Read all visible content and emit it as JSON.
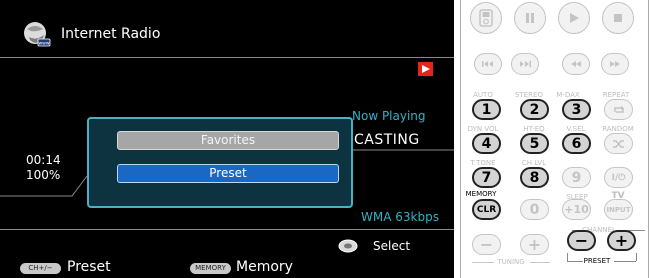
{
  "screen": {
    "source_title": "Internet Radio",
    "now_playing_label": "Now Playing",
    "station_fragment": "CASTING",
    "elapsed_time": "00:14",
    "progress": "100%",
    "codec": "WMA 63kbps",
    "select_label": "Select",
    "footer": {
      "ch_badge": "CH+/−",
      "preset_label": "Preset",
      "memory_badge": "MEMORY",
      "memory_label": "Memory"
    },
    "menu": {
      "items": [
        "Favorites",
        "Preset"
      ],
      "selected": "Preset"
    },
    "colors": {
      "accent_text": "#33b1c7",
      "selected_item": "#1b68c4",
      "play_icon": "#e5251b"
    }
  },
  "remote": {
    "transport": [
      "stop-start",
      "pause-icon",
      "play-icon",
      "stop-icon"
    ],
    "mode_labels": [
      "AUTO",
      "STEREO",
      "M-DAX",
      "REPEAT",
      "DYN VOL",
      "HT-EQ",
      "V.SEL",
      "RANDOM",
      "T.TONE",
      "CH LVL",
      "SLEEP"
    ],
    "numbers": [
      "1",
      "2",
      "3",
      "4",
      "5",
      "6",
      "7",
      "8",
      "9",
      "0",
      "+10"
    ],
    "memory_label": "MEMORY",
    "clr_label": "CLR",
    "tv_label": "TV",
    "input_label": "INPUT",
    "power_label": "I/⏻",
    "channel_label": "CHANNEL",
    "tuning_label": "TUNING",
    "preset_label": "PRESET",
    "minus": "−",
    "plus": "+"
  }
}
